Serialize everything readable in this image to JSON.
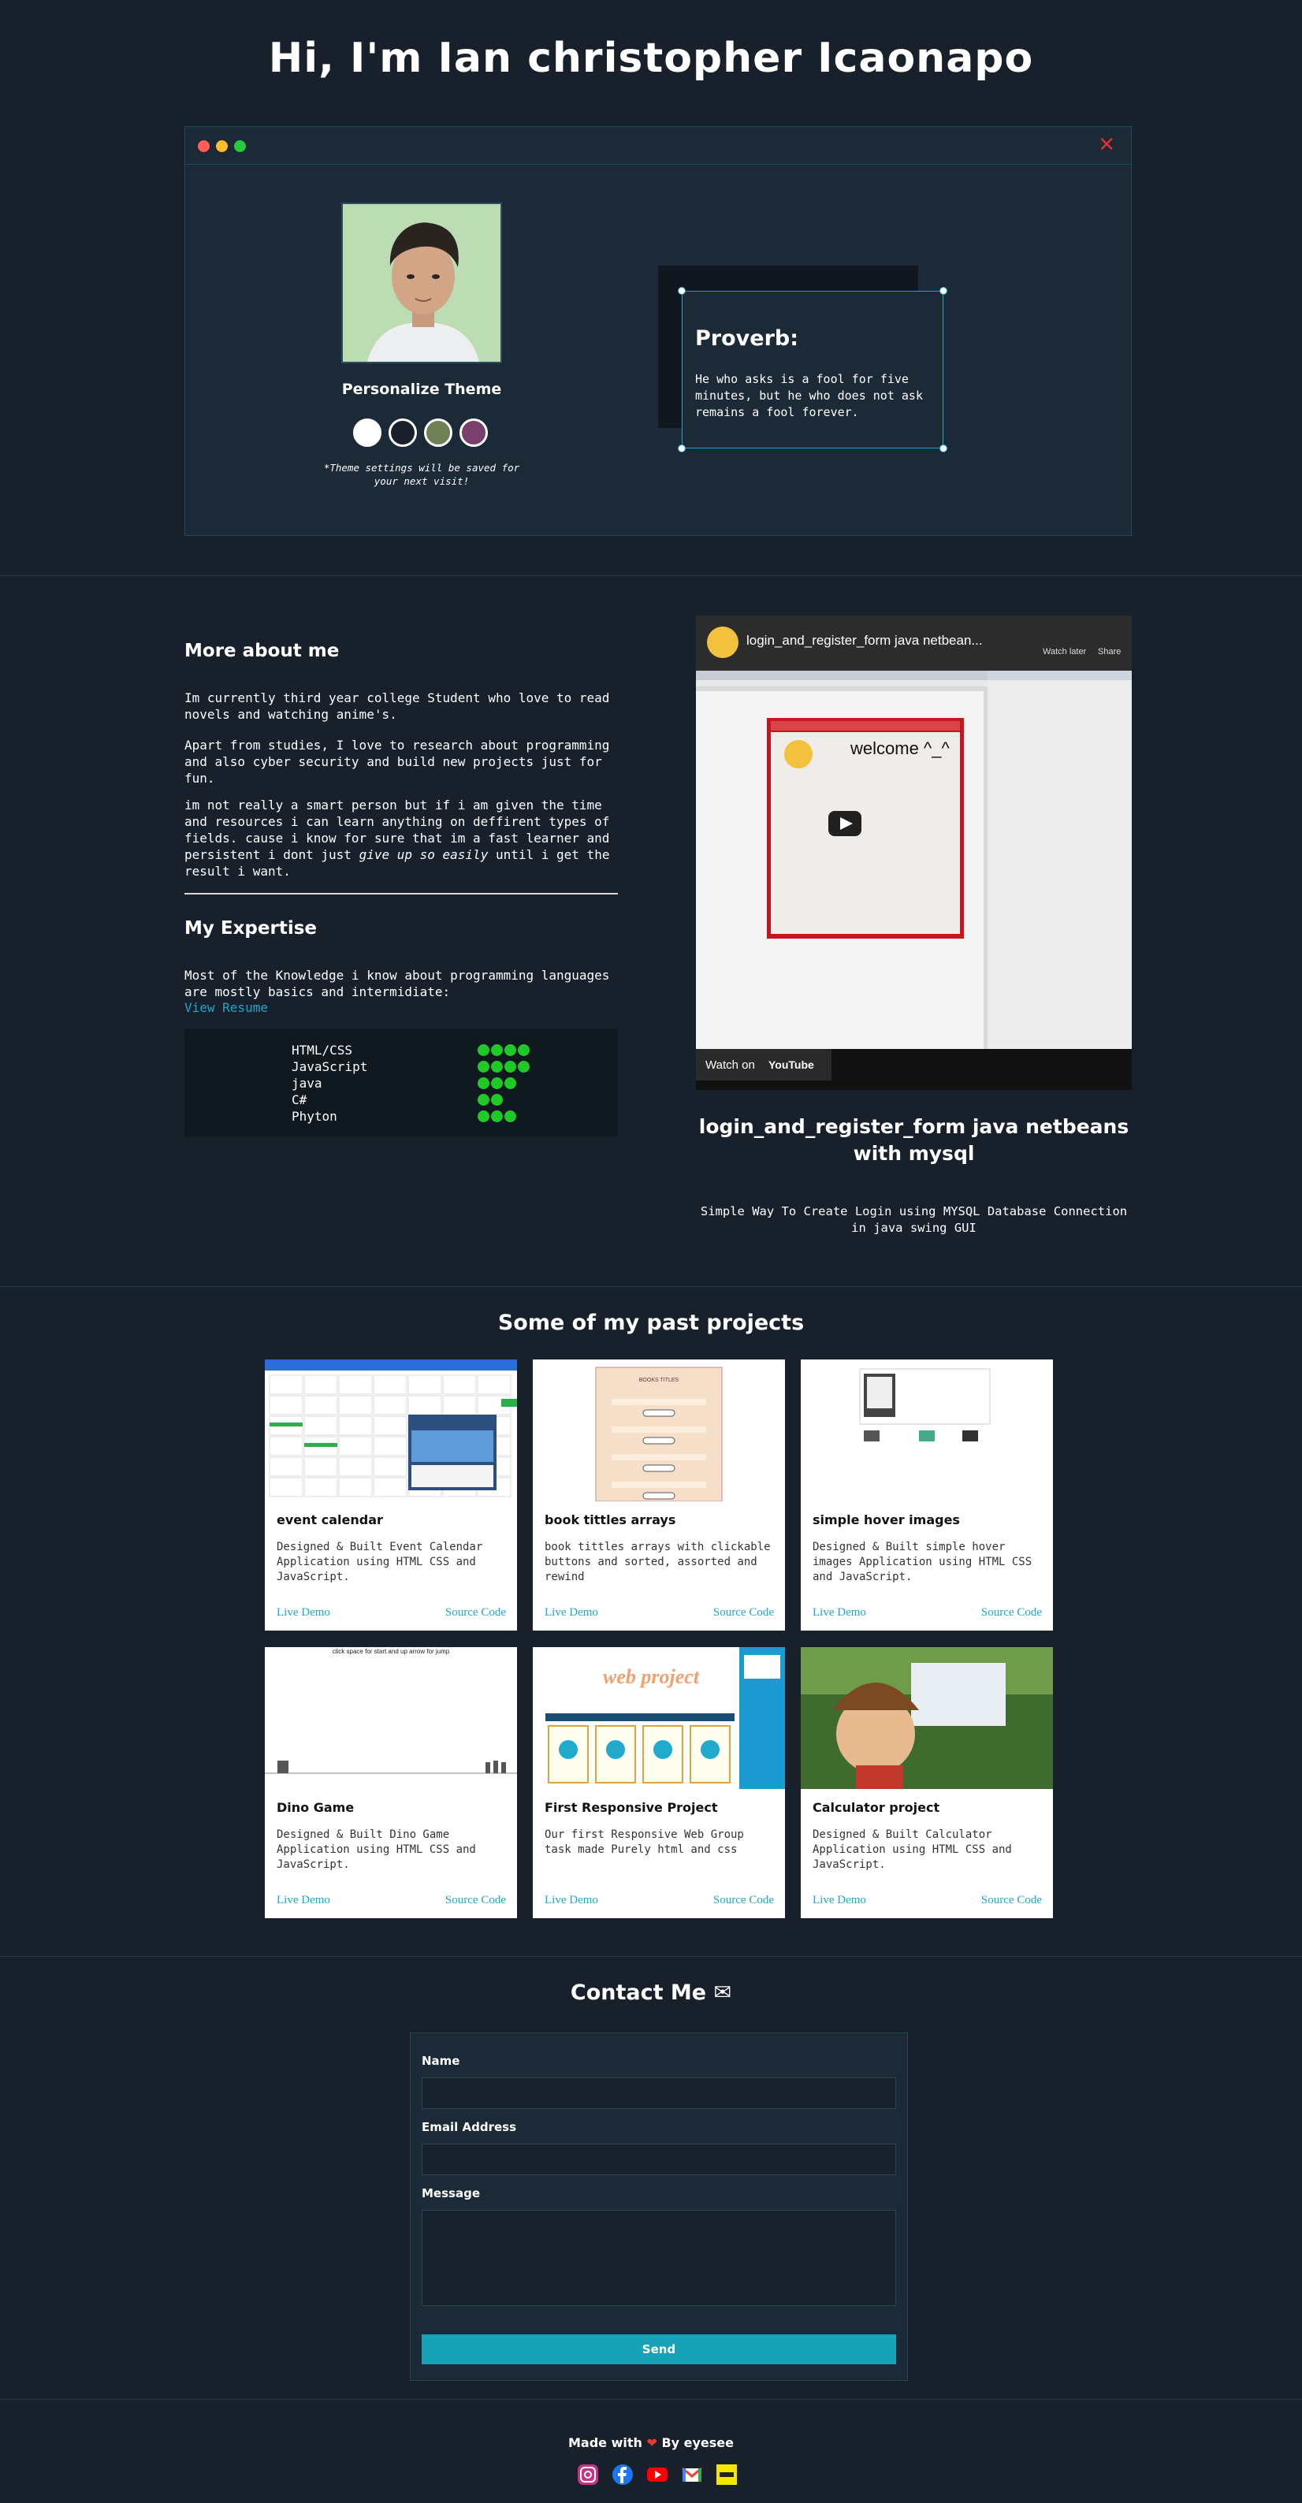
{
  "hero": {
    "title": "Hi, I'm Ian christopher Icaonapo",
    "close_glyph": "✕",
    "theme_title": "Personalize Theme",
    "theme_swatches": [
      "#ffffff",
      "#17202b",
      "#6f8055",
      "#7b3f6e"
    ],
    "theme_note": "*Theme settings will be saved for your next visit!",
    "proverb_title": "Proverb:",
    "proverb_text": "He who asks is a fool for five minutes, but he who does not ask remains a fool forever."
  },
  "about": {
    "heading": "More about me",
    "paragraphs": [
      "Im currently third year college Student who love to read novels and watching anime's.",
      "Apart from studies, I love to research about programming and also cyber security and build new projects just for fun."
    ],
    "para3_before": "im not really a smart person but if i am given the time and resources i can learn anything on deffirent types of fields. cause i know for sure that im a fast learner and persistent i dont just ",
    "para3_em": "give up so easily",
    "para3_after": " until i get the result i want.",
    "expertise_heading": "My Expertise",
    "expertise_text": "Most of the Knowledge i know about programming languages are mostly basics and intermidiate:",
    "resume_link": "View Resume",
    "skills": [
      {
        "name": "HTML/CSS",
        "level": 4
      },
      {
        "name": "JavaScript",
        "level": 4
      },
      {
        "name": "java",
        "level": 3
      },
      {
        "name": "C#",
        "level": 2
      },
      {
        "name": "Phyton",
        "level": 3
      }
    ]
  },
  "video": {
    "overlay_title": "login_and_register_form java netbean...",
    "watch_later": "Watch later",
    "share": "Share",
    "watch_on": "Watch on",
    "youtube": "YouTube",
    "app_welcome": "welcome ^_^",
    "title": "login_and_register_form java netbeans with mysql",
    "description": "Simple Way To Create Login using MYSQL Database Connection in java swing GUI"
  },
  "projects": {
    "heading": "Some of my past projects",
    "demo_label": "Live Demo",
    "source_label": "Source Code",
    "items": [
      {
        "title": "event calendar",
        "desc": "Designed & Built Event Calendar Application using HTML CSS and JavaScript."
      },
      {
        "title": "book tittles arrays",
        "desc": "book tittles arrays with clickable buttons and sorted, assorted and rewind"
      },
      {
        "title": "simple hover images",
        "desc": "Designed & Built simple hover images Application using HTML CSS and JavaScript."
      },
      {
        "title": "Dino Game",
        "desc": "Designed & Built Dino Game Application using HTML CSS and JavaScript."
      },
      {
        "title": "First Responsive Project",
        "desc": "Our first Responsive Web Group task made Purely html and css"
      },
      {
        "title": "Calculator project",
        "desc": "Designed & Built Calculator Application using HTML CSS and JavaScript."
      }
    ],
    "thumb_texts": {
      "dino": "click space for start and up arrow for jump",
      "web_project": "web project",
      "books": "BOOKS TITLES"
    }
  },
  "contact": {
    "heading": "Contact Me",
    "heading_icon": "✉",
    "name_label": "Name",
    "email_label": "Email Address",
    "message_label": "Message",
    "send_label": "Send"
  },
  "footer": {
    "made_with": "Made with",
    "heart": "❤",
    "by": "By eyesee",
    "social_icons": [
      "instagram-icon",
      "facebook-icon",
      "youtube-icon",
      "gmail-icon",
      "dev-icon"
    ]
  }
}
